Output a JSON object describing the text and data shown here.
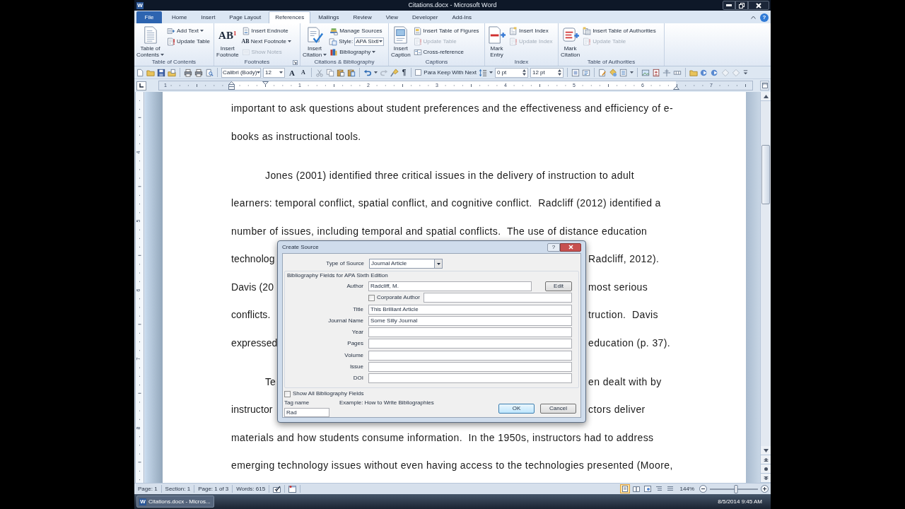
{
  "window": {
    "app_icon": "W",
    "title": "Citations.docx - Microsoft Word"
  },
  "ribbon": {
    "tabs": [
      {
        "label": "File",
        "kind": "file",
        "selected": false
      },
      {
        "label": "Home",
        "kind": "tab",
        "selected": false
      },
      {
        "label": "Insert",
        "kind": "tab",
        "selected": false
      },
      {
        "label": "Page Layout",
        "kind": "tab",
        "selected": false
      },
      {
        "label": "References",
        "kind": "tab",
        "selected": true
      },
      {
        "label": "Mailings",
        "kind": "tab",
        "selected": false
      },
      {
        "label": "Review",
        "kind": "tab",
        "selected": false
      },
      {
        "label": "View",
        "kind": "tab",
        "selected": false
      },
      {
        "label": "Developer",
        "kind": "tab",
        "selected": false
      },
      {
        "label": "Add-Ins",
        "kind": "tab",
        "selected": false
      }
    ],
    "help": "?",
    "groups": [
      {
        "label": "Table of Contents",
        "launcher": false,
        "large": {
          "lines": [
            "Table of",
            "Contents"
          ],
          "dropdown": true
        },
        "small": [
          {
            "kind": "button",
            "label": "Add Text",
            "dropdown": true,
            "disabled": false
          },
          {
            "kind": "button",
            "label": "Update Table",
            "dropdown": false,
            "disabled": false
          }
        ]
      },
      {
        "label": "Footnotes",
        "launcher": true,
        "large": {
          "icon_text": "AB$^{1}$",
          "lines": [
            "Insert",
            "Footnote"
          ],
          "dropdown": false
        },
        "small": [
          {
            "kind": "button",
            "label": "Insert Endnote",
            "dropdown": false,
            "disabled": false
          },
          {
            "kind": "button",
            "icon_text": "AB",
            "label": "Next Footnote",
            "dropdown": true,
            "disabled": false
          },
          {
            "kind": "button",
            "label": "Show Notes",
            "dropdown": false,
            "disabled": true
          }
        ]
      },
      {
        "label": "Citations & Bibliography",
        "launcher": false,
        "large": {
          "lines": [
            "Insert",
            "Citation"
          ],
          "dropdown": true
        },
        "small": [
          {
            "kind": "button",
            "label": "Manage Sources",
            "dropdown": false,
            "disabled": false
          },
          {
            "kind": "select",
            "label": "Style:",
            "value": "APA Sixtl"
          },
          {
            "kind": "button",
            "label": "Bibliography",
            "dropdown": true,
            "disabled": false
          }
        ]
      },
      {
        "label": "Captions",
        "launcher": false,
        "large": {
          "lines": [
            "Insert",
            "Caption"
          ],
          "dropdown": false
        },
        "small": [
          {
            "kind": "button",
            "label": "Insert Table of Figures",
            "dropdown": false,
            "disabled": false
          },
          {
            "kind": "button",
            "label": "Update Table",
            "dropdown": false,
            "disabled": true
          },
          {
            "kind": "button",
            "label": "Cross-reference",
            "dropdown": false,
            "disabled": false
          }
        ]
      },
      {
        "label": "Index",
        "launcher": false,
        "large": {
          "lines": [
            "Mark",
            "Entry"
          ],
          "dropdown": false
        },
        "small": [
          {
            "kind": "button",
            "label": "Insert Index",
            "dropdown": false,
            "disabled": false
          },
          {
            "kind": "button",
            "label": "Update Index",
            "dropdown": false,
            "disabled": true
          }
        ]
      },
      {
        "label": "Table of Authorities",
        "launcher": false,
        "large": {
          "lines": [
            "Mark",
            "Citation"
          ],
          "dropdown": false
        },
        "small": [
          {
            "kind": "button",
            "label": "Insert Table of Authorities",
            "dropdown": false,
            "disabled": false
          },
          {
            "kind": "button",
            "label": "Update Table",
            "dropdown": false,
            "disabled": true
          }
        ]
      }
    ]
  },
  "quick_access": {
    "font": "Calibri (Body)",
    "size": "12",
    "grow_font": "A",
    "shrink_font": "A",
    "show_marks": "¶",
    "keep_with_next": {
      "label": "Para Keep With Next",
      "checked": false
    },
    "space_before": "0 pt",
    "space_after": "12 pt"
  },
  "ruler": {
    "labels": [
      "1",
      "1",
      "2",
      "3",
      "4",
      "5",
      "6",
      "7"
    ]
  },
  "vertical_ruler": {
    "labels": [
      "4",
      "5",
      "6",
      "7",
      "8"
    ]
  },
  "document": {
    "paragraphs": [
      {
        "first_line_indent": false,
        "lines": [
          {
            "kind": "full",
            "text": "important to ask questions about student preferences and the effectiveness and efficiency of e-"
          },
          {
            "kind": "full",
            "text": "books as instructional tools."
          }
        ]
      },
      {
        "first_line_indent": true,
        "lines": [
          {
            "kind": "full",
            "text": "Jones (2001) identified three critical issues in the delivery of instruction to adult"
          },
          {
            "kind": "full",
            "text": "learners: temporal conflict, spatial conflict, and cognitive conflict.  Radcliff (2012) identified a"
          },
          {
            "kind": "full",
            "text": "number of issues, including temporal and spatial conflicts.  The use of distance education"
          },
          {
            "kind": "split",
            "left": "technolog",
            "right": "Radcliff, 2012)."
          },
          {
            "kind": "split",
            "left": "Davis (20",
            "right": "most serious"
          },
          {
            "kind": "split",
            "left": "conflicts.",
            "right": "truction.  Davis"
          },
          {
            "kind": "split",
            "left": "expressed",
            "right": "education (p. 37)."
          }
        ]
      },
      {
        "first_line_indent": true,
        "lines": [
          {
            "kind": "split",
            "left": "Te",
            "right": "en dealt with by"
          },
          {
            "kind": "split",
            "left": "instructor",
            "right": "ctors deliver"
          },
          {
            "kind": "full",
            "text": "materials and how students consume information.  In the 1950s, instructors had to address"
          },
          {
            "kind": "full",
            "text": "emerging technology issues without even having access to the technologies presented (Moore,"
          }
        ]
      }
    ]
  },
  "dialog": {
    "title": "Create Source",
    "help": "?",
    "type_of_source": {
      "label": "Type of Source",
      "value": "Journal Article"
    },
    "group_label": "Bibliography Fields for APA Sixth Edition",
    "fields": [
      {
        "kind": "text_with_button",
        "label": "Author",
        "value": "Radcliff, M.",
        "button": "Edit"
      },
      {
        "kind": "checkbox_field",
        "label": "Corporate Author",
        "checked": false
      },
      {
        "kind": "text",
        "label": "Title",
        "value": "This Brilliant Article"
      },
      {
        "kind": "text",
        "label": "Journal Name",
        "value": "Some Silly Journal"
      },
      {
        "kind": "text",
        "label": "Year"
      },
      {
        "kind": "text",
        "label": "Pages"
      },
      {
        "kind": "text",
        "label": "Volume"
      },
      {
        "kind": "text",
        "label": "Issue"
      },
      {
        "kind": "text",
        "label": "DOI"
      }
    ],
    "show_all": {
      "label": "Show All Bibliography Fields",
      "checked": false
    },
    "tag_name": {
      "label": "Tag name",
      "value": "Rad"
    },
    "example": "Example: How to Write Bibliographies",
    "buttons": [
      {
        "label": "OK",
        "default": true
      },
      {
        "label": "Cancel",
        "default": false
      }
    ]
  },
  "status_bar": {
    "items": [
      "Page: 1",
      "Section: 1",
      "Page: 1 of 3",
      "Words: 615"
    ],
    "views": [
      {
        "selected": true
      },
      {
        "selected": false
      },
      {
        "selected": false
      },
      {
        "selected": false
      },
      {
        "selected": false
      }
    ],
    "zoom": "144%",
    "zoom_slider": {
      "level": 0.55
    }
  },
  "taskbar": {
    "app_icon": "W",
    "window_button": "Citations.docx - Micros...",
    "clock": "8/5/2014 9:45 AM"
  }
}
